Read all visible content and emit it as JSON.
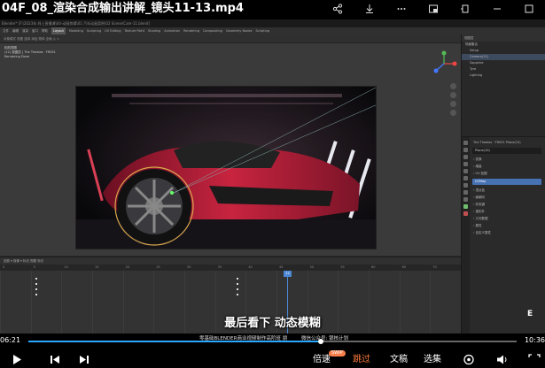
{
  "video": {
    "title": "04F_08_渲染合成输出讲解_镜头11-13.mp4",
    "subtitle": "最后看下 动态模糊",
    "watermark_left": "零基础BLENDER商业视频制作高阶班 朋",
    "watermark_right": "微信公众号: 银核计划",
    "logo": "E",
    "time_current": "06:21",
    "time_total": "10:36",
    "progress": 0.599,
    "controls": {
      "speed_label": "倍速",
      "speed_badge": "SWIP",
      "skip_label": "跳过",
      "chapter_label": "文稿",
      "select_label": "选集"
    }
  },
  "blender": {
    "title_bar": "Blender* [F:\\2023年 线上直播课\\04-动画剪辑\\01 汽车动画案例\\02 Scene\\Cam-11.blend]",
    "menu": [
      "文件",
      "编辑",
      "渲染",
      "窗口",
      "帮助",
      "Layout",
      "Modeling",
      "Sculpting",
      "UV Editing",
      "Texture Paint",
      "Shading",
      "Animation",
      "Rendering",
      "Compositing",
      "Geometry Nodes",
      "Scripting"
    ],
    "menu_active_index": 5,
    "header": "对象模式  视图  选择  添加  物体  全局  ◎  ∿",
    "viewport_overlay": [
      "相机视图",
      "(12) 视图层 | The Thealas · FR051",
      "Rendering Done"
    ],
    "outliner": {
      "header": "视图层",
      "rows": [
        {
          "label": "场景集合",
          "selected": false
        },
        {
          "label": "Setup",
          "selected": false
        },
        {
          "label": "Camera(12)",
          "selected": true
        },
        {
          "label": "Sapphire",
          "selected": false
        },
        {
          "label": "Tyre",
          "selected": false
        },
        {
          "label": "Lighting",
          "selected": false
        }
      ]
    },
    "properties": {
      "rows": [
        {
          "kind": "row",
          "label": "The Thealas · FR051    Plane(10)"
        },
        {
          "kind": "field",
          "label": "Plane(10)",
          "blue": false
        },
        {
          "kind": "row",
          "label": "› 变换"
        },
        {
          "kind": "row",
          "label": "› 增量"
        },
        {
          "kind": "row",
          "label": "› UV 贴图"
        },
        {
          "kind": "field",
          "label": "UVMap",
          "blue": true
        },
        {
          "kind": "row",
          "label": "› 顶点色"
        },
        {
          "kind": "row",
          "label": "› 面朝向"
        },
        {
          "kind": "row",
          "label": "› 形态键"
        },
        {
          "kind": "row",
          "label": "› 重拓扑"
        },
        {
          "kind": "row",
          "label": "› 几何数据"
        },
        {
          "kind": "row",
          "label": "› 属性"
        },
        {
          "kind": "row",
          "label": "› 自定义属性"
        }
      ]
    },
    "timeline": {
      "header": "回放 ▾  抠像 ▾  标记  视图  标记",
      "frame_current": "12",
      "frame_start": "1",
      "frame_end": "88",
      "ruler": [
        "0",
        "5",
        "10",
        "15",
        "20",
        "25",
        "30",
        "35",
        "40",
        "45",
        "50",
        "55",
        "60",
        "65",
        "70"
      ]
    }
  }
}
